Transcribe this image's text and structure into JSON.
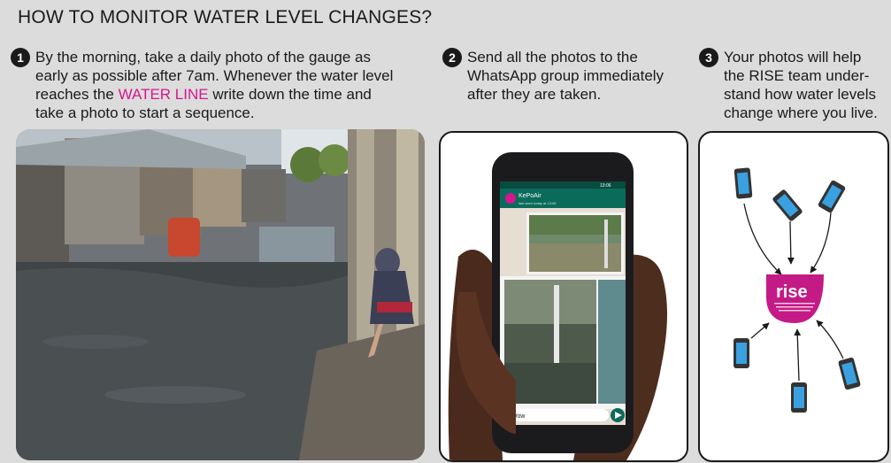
{
  "title": "HOW TO MONITOR WATER LEVEL CHANGES?",
  "steps": [
    {
      "number": "1",
      "lines": [
        "By the morning, take a daily photo of the gauge as",
        "early as possible after 7am. Whenever the water level",
        "reaches the",
        "WATER LINE",
        "write down the time and",
        "take a photo to start a sequence."
      ]
    },
    {
      "number": "2",
      "lines": [
        "Send all the photos to the",
        "WhatsApp group immediately",
        "after they are taken."
      ]
    },
    {
      "number": "3",
      "lines": [
        "Your photos will help",
        "the RISE team under-",
        "stand how water levels",
        "change where you live."
      ]
    }
  ],
  "phone": {
    "status_time": "13:06",
    "chat_name": "KePoAir",
    "chat_subtitle": "last seen today at 13:06",
    "message_input": "Wow"
  },
  "rise": {
    "logo": "rise"
  },
  "colors": {
    "accent": "#d6168f",
    "whatsapp_green": "#0b6b5b",
    "panel_border": "#1a1a1a",
    "background": "#dcdcdc"
  }
}
